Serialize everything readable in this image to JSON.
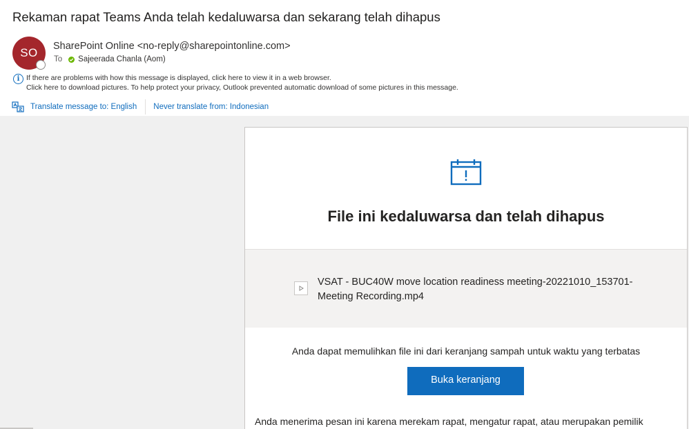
{
  "message": {
    "subject": "Rekaman rapat Teams Anda telah kedaluwarsa dan sekarang telah dihapus",
    "sender": {
      "initials": "SO",
      "display": "SharePoint Online <no-reply@sharepointonline.com>",
      "avatar_color": "#a4262c"
    },
    "to": {
      "label": "To",
      "recipient": "Sajeerada Chanla (Aom)"
    },
    "info": {
      "icon": "info-icon",
      "line1": "If there are problems with how this message is displayed, click here to view it in a web browser.",
      "line2": "Click here to download pictures. To help protect your privacy, Outlook prevented automatic download of some pictures in this message."
    },
    "translate": {
      "icon": "translate-icon",
      "translate_link": "Translate message to: English",
      "never_link": "Never translate from: Indonesian"
    }
  },
  "card": {
    "icon": "calendar-alert-icon",
    "title": "File ini kedaluwarsa dan telah dihapus",
    "file": {
      "icon": "video-file-icon",
      "name": "VSAT - BUC40W move location readiness meeting-20221010_153701-Meeting Recording.mp4"
    },
    "restore_text": "Anda dapat memulihkan file ini dari keranjang sampah untuk waktu yang terbatas",
    "open_button": "Buka keranjang",
    "reason_text": "Anda menerima pesan ini karena merekam rapat, mengatur rapat, atau merupakan pemilik"
  },
  "colors": {
    "accent": "#0f6cbd",
    "presence_ok": "#6bb700",
    "body_bg": "#f0f0f0"
  }
}
